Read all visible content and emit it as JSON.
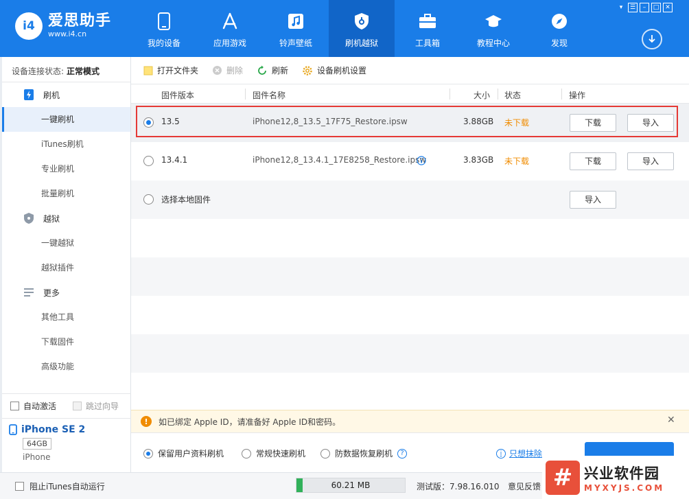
{
  "app": {
    "name": "爱思助手",
    "url": "www.i4.cn",
    "logo_badge": "i4"
  },
  "nav": [
    {
      "label": "我的设备",
      "icon": "phone-icon"
    },
    {
      "label": "应用游戏",
      "icon": "app-store-icon"
    },
    {
      "label": "铃声壁纸",
      "icon": "music-icon"
    },
    {
      "label": "刷机越狱",
      "icon": "shield-key-icon",
      "active": true
    },
    {
      "label": "工具箱",
      "icon": "toolbox-icon"
    },
    {
      "label": "教程中心",
      "icon": "graduation-cap-icon"
    },
    {
      "label": "发现",
      "icon": "compass-icon"
    }
  ],
  "window_controls": [
    "shirt-icon",
    "menu-icon",
    "minimize-icon",
    "maximize-icon",
    "close-icon"
  ],
  "sidebar": {
    "status_label": "设备连接状态:",
    "status_value": "正常模式",
    "groups": [
      {
        "label": "刷机",
        "icon": "phone-flash-icon",
        "items": [
          "一键刷机",
          "iTunes刷机",
          "专业刷机",
          "批量刷机"
        ]
      },
      {
        "label": "越狱",
        "icon": "shield-icon",
        "items": [
          "一键越狱",
          "越狱插件"
        ]
      },
      {
        "label": "更多",
        "icon": "list-icon",
        "items": [
          "其他工具",
          "下载固件",
          "高级功能"
        ]
      }
    ],
    "active_item": "一键刷机",
    "auto_activate": "自动激活",
    "skip_guide": "跳过向导",
    "device": {
      "name": "iPhone SE 2",
      "capacity": "64GB",
      "model": "iPhone"
    }
  },
  "toolbar": {
    "open_folder": "打开文件夹",
    "delete": "删除",
    "refresh": "刷新",
    "settings": "设备刷机设置"
  },
  "table": {
    "headers": {
      "version": "固件版本",
      "name": "固件名称",
      "size": "大小",
      "status": "状态",
      "actions": "操作"
    },
    "rows": [
      {
        "version": "13.5",
        "name": "iPhone12,8_13.5_17F75_Restore.ipsw",
        "size": "3.88GB",
        "status": "未下载",
        "download": "下载",
        "import": "导入",
        "selected": true
      },
      {
        "version": "13.4.1",
        "name": "iPhone12,8_13.4.1_17E8258_Restore.ipsw",
        "size": "3.83GB",
        "status": "未下载",
        "download": "下载",
        "import": "导入",
        "info": true
      },
      {
        "version": "选择本地固件",
        "import": "导入"
      }
    ]
  },
  "notice": {
    "text": "如已绑定 Apple ID，请准备好 Apple ID和密码。"
  },
  "options": {
    "keep_data": "保留用户资料刷机",
    "quick": "常规快速刷机",
    "recovery": "防数据恢复刷机",
    "erase_link": "只想抹除"
  },
  "statusbar": {
    "block_itunes": "阻止iTunes自动运行",
    "memory": "60.21 MB",
    "memory_fraction": 0.06,
    "version": "测试版：7.98.16.010",
    "feedback": "意见反馈"
  },
  "watermark": {
    "cn": "兴业软件园",
    "en": "MYXYJS.COM",
    "mark": "#"
  },
  "colors": {
    "brand": "#1a7de8",
    "warn": "#f08c00",
    "highlight": "#e53935"
  }
}
